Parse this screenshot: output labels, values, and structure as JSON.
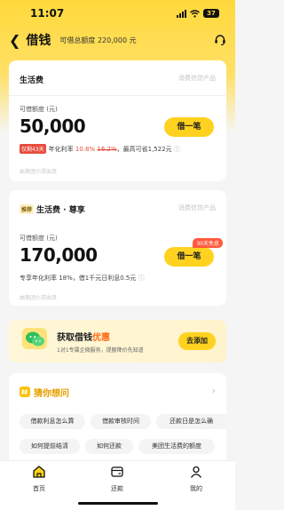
{
  "status": {
    "time": "11:07",
    "battery": "37"
  },
  "nav": {
    "title": "借钱",
    "subtitle": "可借总额度 220,000 元"
  },
  "card1": {
    "name": "生活费",
    "type": "消费信贷产品",
    "amount_label": "可借额度 (元)",
    "amount": "50,000",
    "button": "借一笔",
    "tag": "仅剩43天",
    "rate_prefix": "年化利率",
    "rate_new": "10.8%",
    "rate_old": "16.2%",
    "rate_suffix": "，最高可省1,522元",
    "footer": "由美团小贷出资"
  },
  "card2": {
    "tag": "推荐",
    "name": "生活费 · 尊享",
    "type": "消费信贷产品",
    "amount_label": "可借额度 (元)",
    "amount": "170,000",
    "button": "借一笔",
    "badge": "30天免息",
    "rate_line": "专享年化利率 18%，借1千元日利息0.5元",
    "footer": "由美团小贷出资"
  },
  "promo": {
    "title_main": "获取借钱",
    "title_highlight": "优惠",
    "subtitle": "1对1专属企微服务，提额降价先知道",
    "button": "去添加"
  },
  "faq": {
    "title": "猜你想问",
    "chips": [
      "借款利息怎么算",
      "借款审核时间",
      "还款日是怎么确",
      "如何提前结清",
      "如何还款",
      "美团生活费的额度"
    ]
  },
  "tabs": [
    {
      "label": "首页",
      "icon": "home-icon"
    },
    {
      "label": "还款",
      "icon": "wallet-icon"
    },
    {
      "label": "我的",
      "icon": "user-icon"
    }
  ],
  "colors": {
    "accent": "#ffd21f",
    "red": "#e74c3c",
    "faq_title": "#e6a000"
  }
}
